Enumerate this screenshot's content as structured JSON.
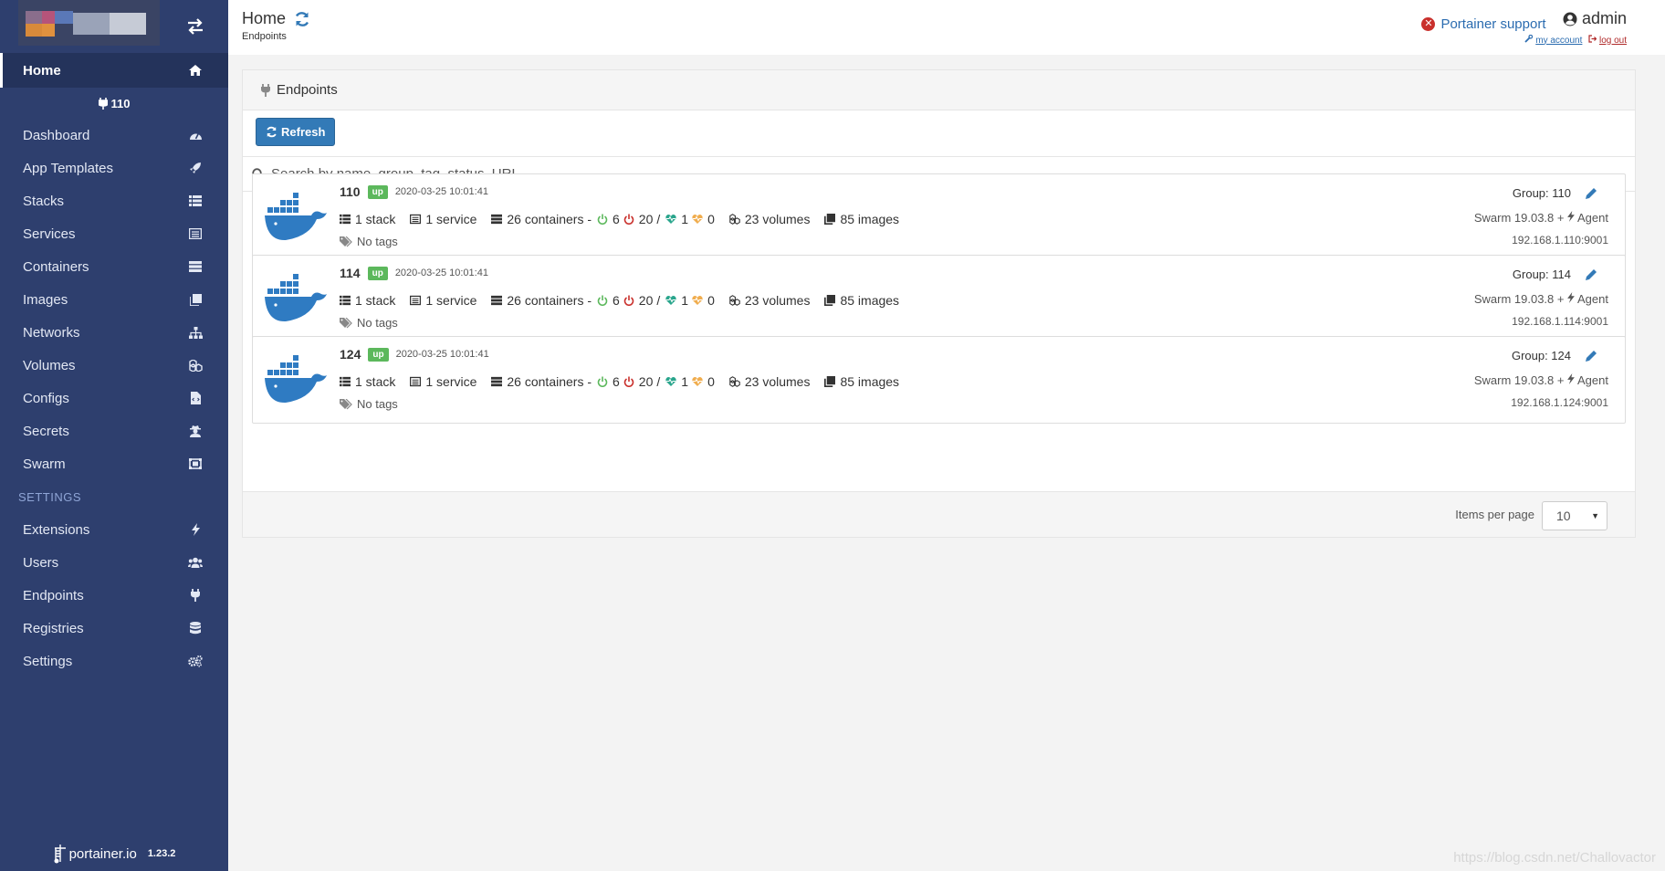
{
  "sidebar": {
    "home": "Home",
    "endpoint_badge": "110",
    "items": [
      {
        "label": "Dashboard"
      },
      {
        "label": "App Templates"
      },
      {
        "label": "Stacks"
      },
      {
        "label": "Services"
      },
      {
        "label": "Containers"
      },
      {
        "label": "Images"
      },
      {
        "label": "Networks"
      },
      {
        "label": "Volumes"
      },
      {
        "label": "Configs"
      },
      {
        "label": "Secrets"
      },
      {
        "label": "Swarm"
      }
    ],
    "settings_title": "SETTINGS",
    "settings_items": [
      {
        "label": "Extensions"
      },
      {
        "label": "Users"
      },
      {
        "label": "Endpoints"
      },
      {
        "label": "Registries"
      },
      {
        "label": "Settings"
      }
    ],
    "footer_brand": "portainer.io",
    "footer_version": "1.23.2"
  },
  "header": {
    "title": "Home",
    "breadcrumb": "Endpoints",
    "support": "Portainer support",
    "user": "admin",
    "my_account": "my account",
    "log_out": "log out"
  },
  "widget": {
    "title": "Endpoints",
    "refresh_label": "Refresh",
    "search_placeholder": "Search by name, group, tag, status, URL...",
    "items_per_page_label": "Items per page",
    "items_per_page": "10"
  },
  "endpoints": [
    {
      "name": "110",
      "status": "up",
      "timestamp": "2020-03-25 10:01:41",
      "stacks": "1 stack",
      "services": "1 service",
      "containers": "26 containers -",
      "running": "6",
      "stopped": "20",
      "sep": "/",
      "healthy": "1",
      "unhealthy": "0",
      "volumes": "23 volumes",
      "images": "85 images",
      "tags": "No tags",
      "group": "Group: 110",
      "swarm": "Swarm 19.03.8 +",
      "agent": "Agent",
      "url": "192.168.1.110:9001"
    },
    {
      "name": "114",
      "status": "up",
      "timestamp": "2020-03-25 10:01:41",
      "stacks": "1 stack",
      "services": "1 service",
      "containers": "26 containers -",
      "running": "6",
      "stopped": "20",
      "sep": "/",
      "healthy": "1",
      "unhealthy": "0",
      "volumes": "23 volumes",
      "images": "85 images",
      "tags": "No tags",
      "group": "Group: 114",
      "swarm": "Swarm 19.03.8 +",
      "agent": "Agent",
      "url": "192.168.1.114:9001"
    },
    {
      "name": "124",
      "status": "up",
      "timestamp": "2020-03-25 10:01:41",
      "stacks": "1 stack",
      "services": "1 service",
      "containers": "26 containers -",
      "running": "6",
      "stopped": "20",
      "sep": "/",
      "healthy": "1",
      "unhealthy": "0",
      "volumes": "23 volumes",
      "images": "85 images",
      "tags": "No tags",
      "group": "Group: 124",
      "swarm": "Swarm 19.03.8 +",
      "agent": "Agent",
      "url": "192.168.1.124:9001"
    }
  ],
  "watermark": "https://blog.csdn.net/Challovactor",
  "colors": {
    "sidebar": "#2e3f6e",
    "primary": "#337ab7",
    "up": "#5cb85c"
  }
}
